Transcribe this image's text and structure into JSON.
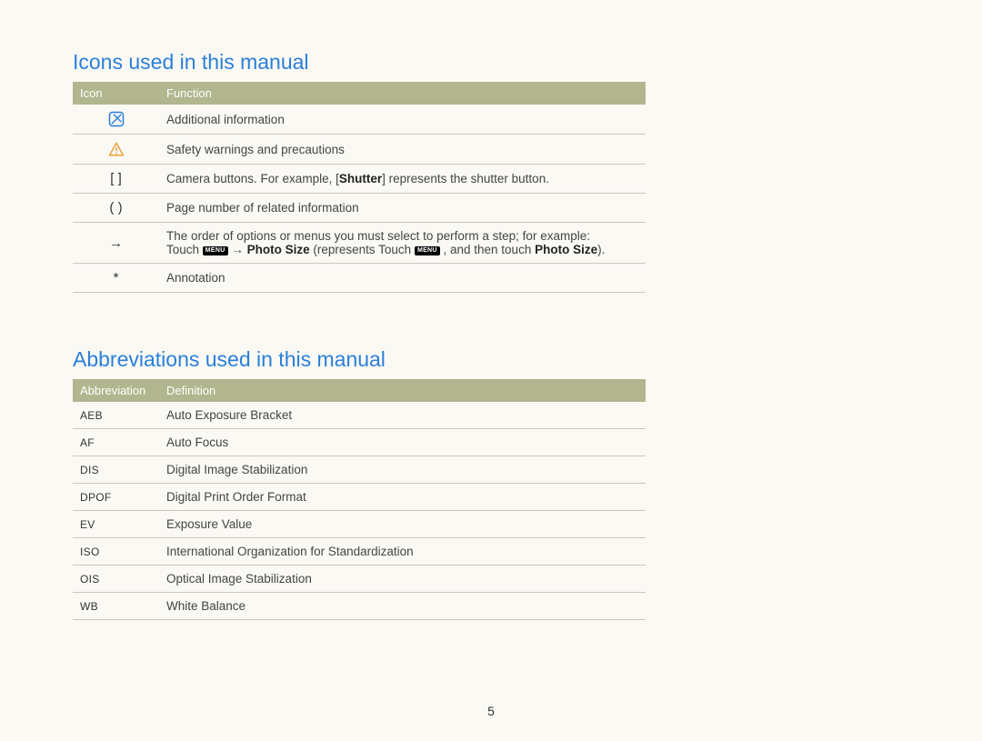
{
  "sections": {
    "icons": {
      "heading": "Icons used in this manual",
      "headers": {
        "c1": "Icon",
        "c2": "Function"
      },
      "rows": [
        {
          "function": "Additional information"
        },
        {
          "function": "Safety warnings and precautions"
        },
        {
          "icon": "[  ]",
          "function_prefix": "Camera buttons. For example, [",
          "function_bold": "Shutter",
          "function_suffix": "] represents the shutter button."
        },
        {
          "icon": "(  )",
          "function": "Page number of related information"
        },
        {
          "icon": "→",
          "line1": "The order of options or menus you must select to perform a step; for example:",
          "line2_a": "Touch ",
          "line2_menu1": "MENU",
          "line2_b": " → ",
          "line2_bold1": "Photo Size",
          "line2_c": " (represents Touch ",
          "line2_menu2": "MENU",
          "line2_d": " , and then touch ",
          "line2_bold2": "Photo Size",
          "line2_e": ")."
        },
        {
          "icon": "*",
          "function": "Annotation"
        }
      ]
    },
    "abbr": {
      "heading": "Abbreviations used in this manual",
      "headers": {
        "c1": "Abbreviation",
        "c2": "Definition"
      },
      "rows": [
        {
          "abbr": "AEB",
          "def": "Auto Exposure Bracket"
        },
        {
          "abbr": "AF",
          "def": "Auto Focus"
        },
        {
          "abbr": "DIS",
          "def": "Digital Image Stabilization"
        },
        {
          "abbr": "DPOF",
          "def": "Digital Print Order Format"
        },
        {
          "abbr": "EV",
          "def": "Exposure Value"
        },
        {
          "abbr": "ISO",
          "def": "International Organization for Standardization"
        },
        {
          "abbr": "OIS",
          "def": "Optical Image Stabilization"
        },
        {
          "abbr": "WB",
          "def": "White Balance"
        }
      ]
    }
  },
  "page_number": "5"
}
